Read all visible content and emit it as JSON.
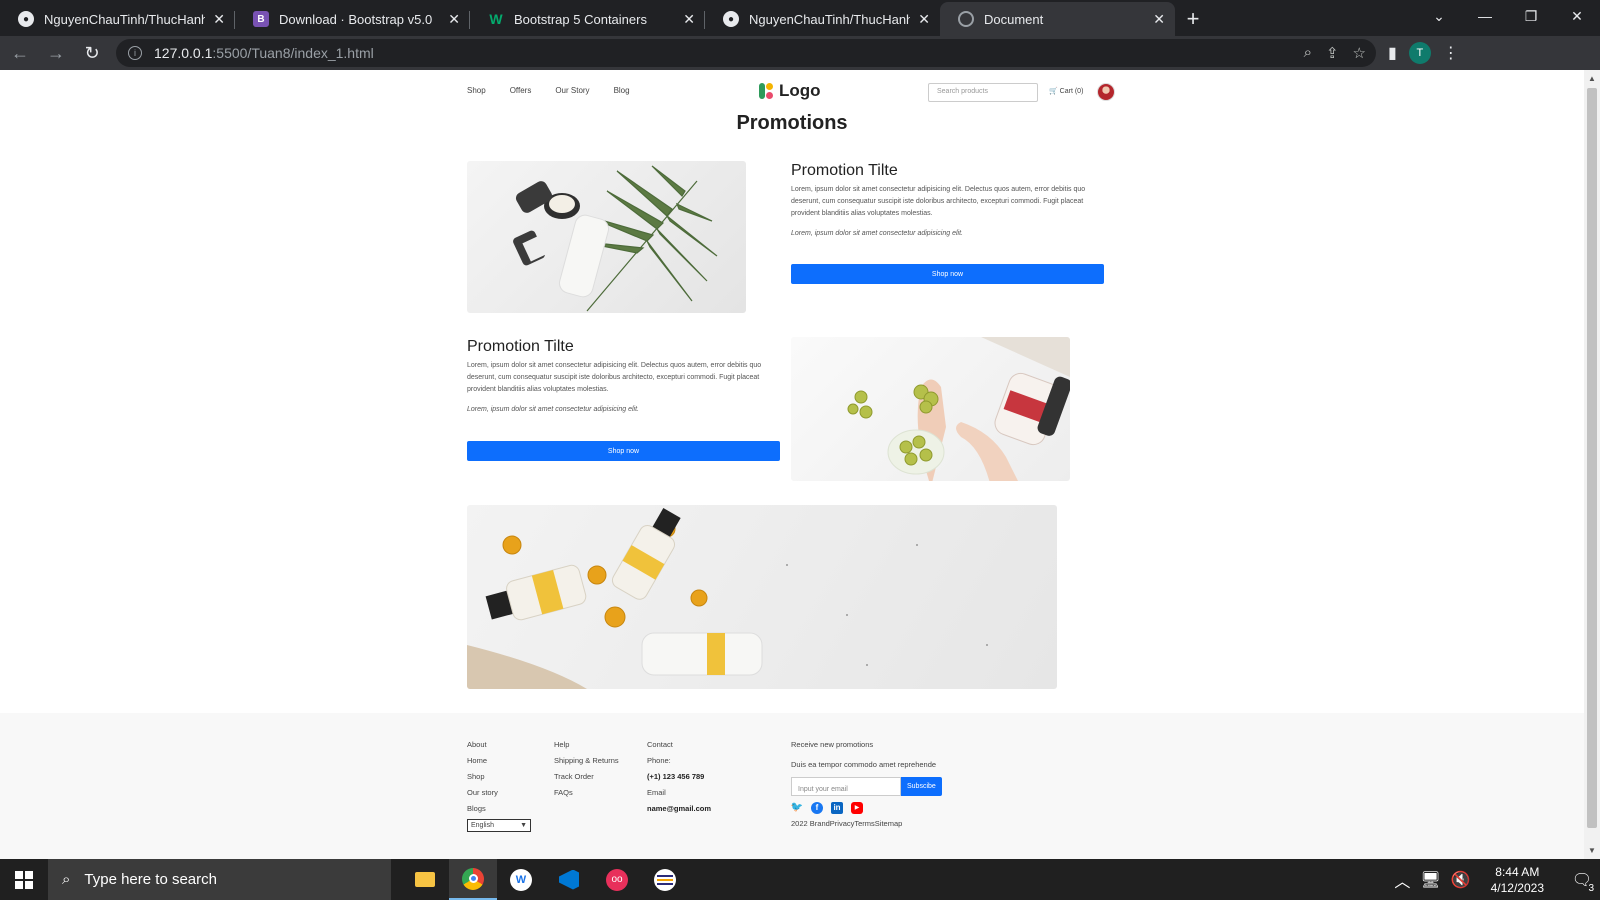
{
  "browser": {
    "tabs": [
      {
        "title": "NguyenChauTinh/ThucHanhWeb",
        "icon": "github-icon"
      },
      {
        "title": "Download · Bootstrap v5.0",
        "icon": "bootstrap-icon"
      },
      {
        "title": "Bootstrap 5 Containers",
        "icon": "w3schools-icon"
      },
      {
        "title": "NguyenChauTinh/ThucHanhWeb",
        "icon": "github-icon"
      },
      {
        "title": "Document",
        "icon": "globe-icon"
      }
    ],
    "url_host": "127.0.0.1",
    "url_path": ":5500/Tuan8/index_1.html",
    "profile_initial": "T"
  },
  "site": {
    "nav": [
      "Shop",
      "Offers",
      "Our Story",
      "Blog"
    ],
    "brand": "Logo",
    "search_placeholder": "Search products",
    "cart": "Cart (0)",
    "page_title": "Promotions",
    "promos": [
      {
        "title": "Promotion Tilte",
        "body": "Lorem, ipsum dolor sit amet consectetur adipisicing elit. Delectus quos autem, error debitis quo deserunt, cum consequatur suscipit iste doloribus architecto, excepturi commodi. Fugit placeat provident blanditiis alias voluptates molestias.",
        "note": "Lorem, ipsum dolor sit amet consectetur adipisicing elit.",
        "button": "Shop now"
      },
      {
        "title": "Promotion Tilte",
        "body": "Lorem, ipsum dolor sit amet consectetur adipisicing elit. Delectus quos autem, error debitis quo deserunt, cum consequatur suscipit iste doloribus architecto, excepturi commodi. Fugit placeat provident blanditiis alias voluptates molestias.",
        "note": "Lorem, ipsum dolor sit amet consectetur adipisicing elit.",
        "button": "Shop now"
      }
    ]
  },
  "footer": {
    "col1": [
      "About",
      "Home",
      "Shop",
      "Our story",
      "Blogs"
    ],
    "language": "English",
    "col2": [
      "Help",
      "Shipping & Returns",
      "Track Order",
      "FAQs"
    ],
    "contact": {
      "heading": "Contact",
      "phone_label": "Phone:",
      "phone": "(+1) 123 456 789",
      "email_label": "Email",
      "email": "name@gmail.com"
    },
    "newsletter": {
      "heading": "Receive new promotions",
      "sub": "Duis ea tempor commodo amet reprehende",
      "placeholder": "Input your email",
      "button": "Subscibe",
      "copyright": "2022 BrandPrivacyTermsSitemap"
    },
    "socials": [
      "twitter-icon",
      "facebook-icon",
      "linkedin-icon",
      "youtube-icon"
    ]
  },
  "taskbar": {
    "search_placeholder": "Type here to search",
    "time": "8:44 AM",
    "date": "4/12/2023",
    "notification_count": "3"
  },
  "colors": {
    "primary_button": "#0d6efd",
    "chrome_dark": "#202124",
    "chrome_mid": "#35363a"
  }
}
